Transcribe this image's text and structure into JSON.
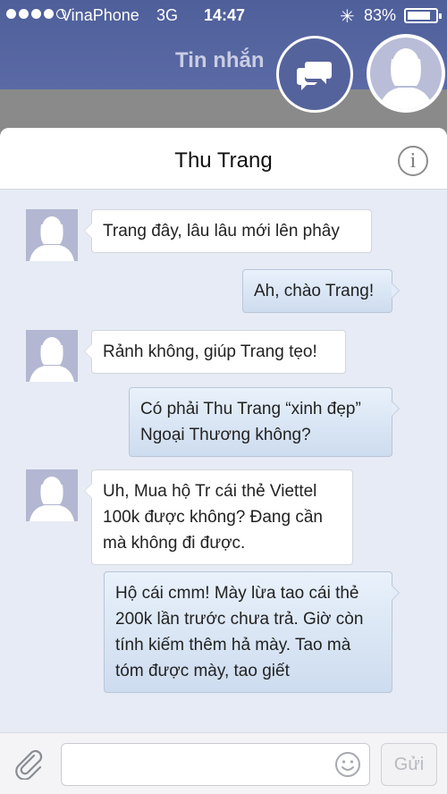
{
  "status_bar": {
    "carrier": "VinaPhone",
    "network": "3G",
    "time": "14:47",
    "battery": "83%",
    "battery_level": 0.83,
    "signal_bars": 4,
    "signal_total": 5
  },
  "nav": {
    "title": "Tin nhắn",
    "chat_icon": "chat-bubbles-icon",
    "avatar_icon": "user-silhouette-icon"
  },
  "chat": {
    "contact_name": "Thu Trang",
    "info_label": "i",
    "messages": [
      {
        "direction": "in",
        "lines": [
          "Trang đây, lâu lâu mới lên phây"
        ]
      },
      {
        "direction": "out",
        "lines": [
          "Ah, chào Trang!"
        ]
      },
      {
        "direction": "in",
        "lines": [
          "Rảnh không, giúp Trang tẹo!"
        ]
      },
      {
        "direction": "out",
        "lines": [
          "Có phải Thu Trang “xinh đẹp”",
          "Ngoại Thương không?"
        ]
      },
      {
        "direction": "in",
        "lines": [
          "Uh, Mua hộ Tr cái thẻ Viettel",
          "100k được không? Đang cần",
          "mà không đi được."
        ]
      },
      {
        "direction": "out",
        "lines": [
          "Hộ cái cmm! Mày lừa tao cái thẻ",
          "200k lần trước chưa trả. Giờ còn",
          "tính kiếm thêm hả mày. Tao mà",
          "tóm được mày, tao giết"
        ]
      }
    ]
  },
  "composer": {
    "input_value": "",
    "attach_icon": "paperclip-icon",
    "emoji_icon": "smiley-icon",
    "send_label": "Gửi"
  },
  "colors": {
    "header_bg": "#5b6aa5",
    "chat_bg": "#e7ebf5",
    "incoming_bubble": "#ffffff",
    "outgoing_bubble": "#d6e3f4"
  }
}
